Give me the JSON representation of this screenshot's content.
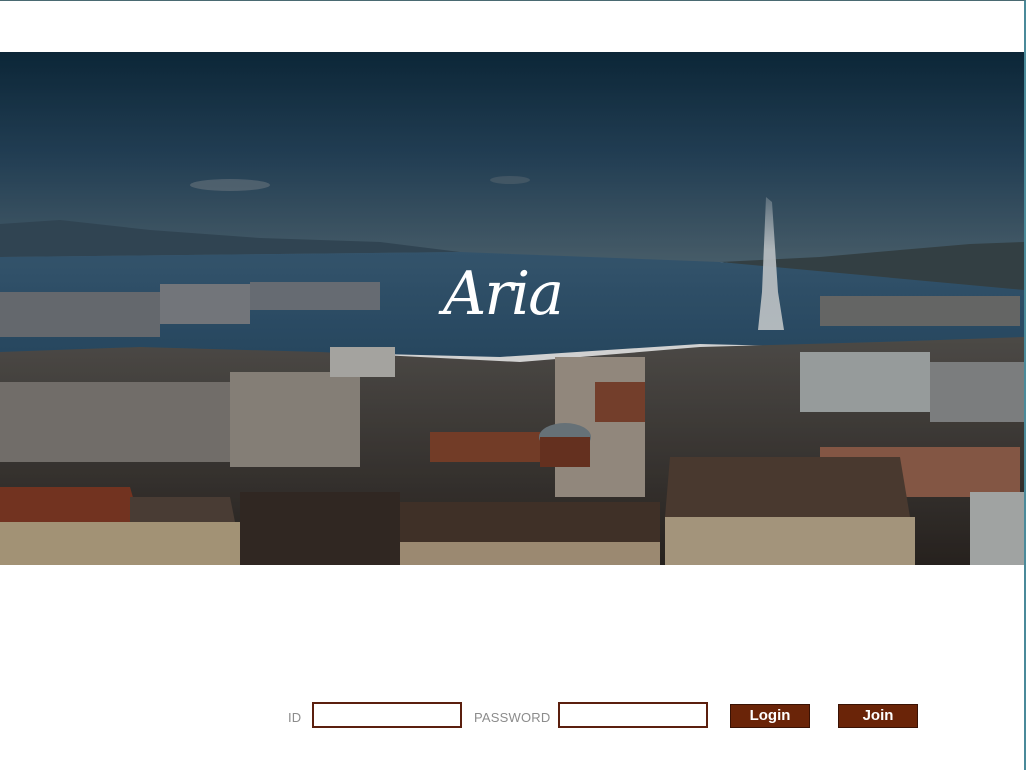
{
  "brand": {
    "logo_text": "Aria"
  },
  "hero": {
    "image": "city-lake-fountain-panorama"
  },
  "login": {
    "id_label": "ID",
    "id_value": "",
    "password_label": "PASSWORD",
    "password_value": "",
    "login_button": "Login",
    "join_button": "Join"
  },
  "colors": {
    "button_bg": "#6a2408",
    "field_border": "#5b1f0e",
    "label": "#8c8c8c"
  }
}
